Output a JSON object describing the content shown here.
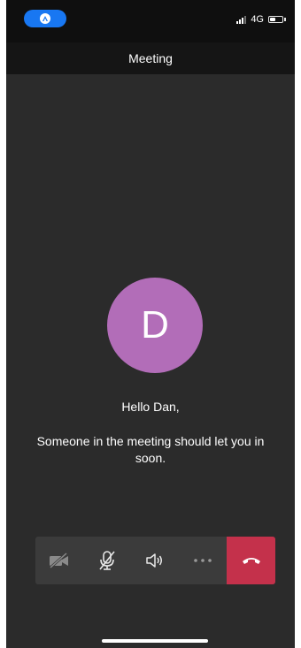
{
  "header": {
    "title": "Meeting"
  },
  "status_bar": {
    "network": "4G"
  },
  "participant": {
    "initial": "D"
  },
  "lobby": {
    "greeting": "Hello Dan,",
    "message": "Someone in the meeting should let you in soon."
  },
  "controls": {
    "items": [
      {
        "name": "camera-off",
        "icon": "camera-off-icon"
      },
      {
        "name": "mic-muted",
        "icon": "mic-off-icon"
      },
      {
        "name": "speaker",
        "icon": "speaker-icon"
      },
      {
        "name": "more",
        "icon": "more-icon"
      },
      {
        "name": "hang-up",
        "icon": "hang-up-icon"
      }
    ]
  },
  "colors": {
    "avatar": "#b26db8",
    "hangup": "#c4314b",
    "background": "#2b2b2b",
    "pill": "#1877f2"
  }
}
